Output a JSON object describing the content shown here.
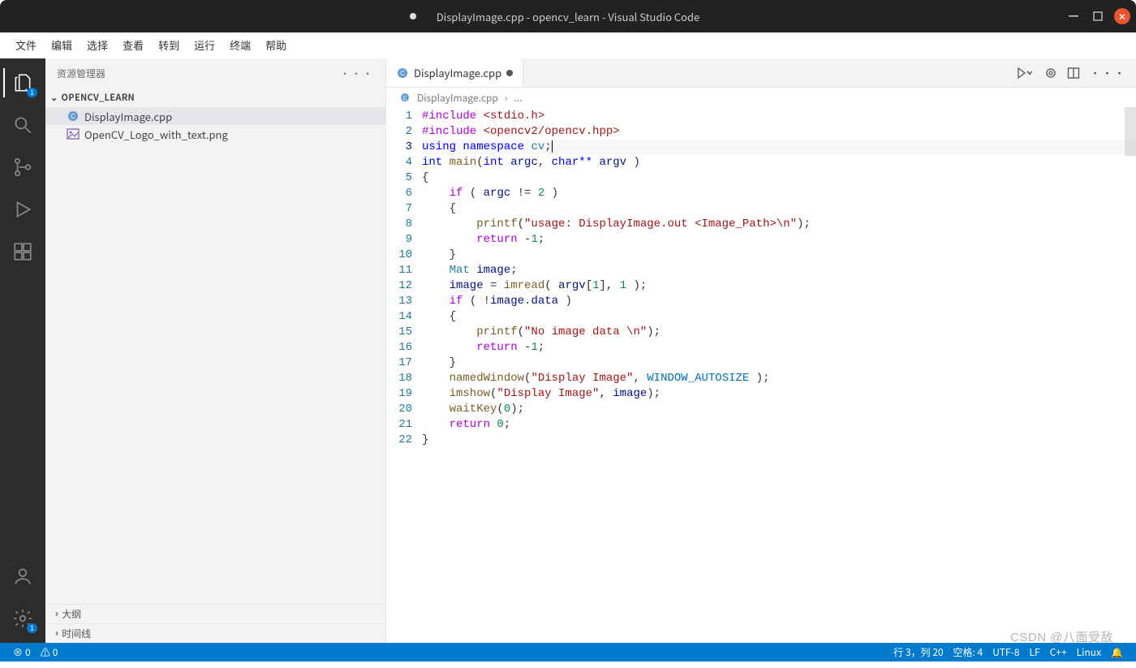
{
  "window": {
    "title": "DisplayImage.cpp - opencv_learn - Visual Studio Code",
    "modified": true
  },
  "menubar": {
    "items": [
      "文件",
      "编辑",
      "选择",
      "查看",
      "转到",
      "运行",
      "终端",
      "帮助"
    ]
  },
  "activitybar": {
    "top": [
      {
        "name": "explorer",
        "badge": "1",
        "active": true
      },
      {
        "name": "search"
      },
      {
        "name": "source-control"
      },
      {
        "name": "run-debug"
      },
      {
        "name": "extensions"
      }
    ],
    "bottom": [
      {
        "name": "accounts"
      },
      {
        "name": "manage",
        "badge": "1"
      }
    ]
  },
  "sidebar": {
    "title": "资源管理器",
    "more": "···",
    "folder": "OPENCV_LEARN",
    "files": [
      {
        "name": "DisplayImage.cpp",
        "icon": "cpp",
        "active": true
      },
      {
        "name": "OpenCV_Logo_with_text.png",
        "icon": "image",
        "active": false
      }
    ],
    "sections": [
      {
        "label": "大纲"
      },
      {
        "label": "时间线"
      }
    ]
  },
  "editor": {
    "tab": {
      "label": "DisplayImage.cpp",
      "modified": true
    },
    "breadcrumb": {
      "file": "DisplayImage.cpp",
      "segment": "..."
    },
    "toolbar_icons": [
      "run-dropdown",
      "split-icon",
      "layout-icon",
      "more-icon"
    ],
    "lines": 22,
    "cursor_line": 3,
    "code": [
      [
        {
          "t": "#include ",
          "c": "k-pp"
        },
        {
          "t": "<stdio.h>",
          "c": "k-str"
        }
      ],
      [
        {
          "t": "#include ",
          "c": "k-pp"
        },
        {
          "t": "<opencv2/opencv.hpp>",
          "c": "k-str"
        }
      ],
      [
        {
          "t": "using ",
          "c": "k-kw"
        },
        {
          "t": "namespace ",
          "c": "k-kw"
        },
        {
          "t": "cv",
          "c": "k-type"
        },
        {
          "t": ";",
          "c": ""
        }
      ],
      [
        {
          "t": "int ",
          "c": "k-kw"
        },
        {
          "t": "main",
          "c": "k-fn"
        },
        {
          "t": "(",
          "c": ""
        },
        {
          "t": "int ",
          "c": "k-kw"
        },
        {
          "t": "argc",
          "c": "k-var"
        },
        {
          "t": ", ",
          "c": ""
        },
        {
          "t": "char** ",
          "c": "k-kw"
        },
        {
          "t": "argv",
          "c": "k-var"
        },
        {
          "t": " )",
          "c": ""
        }
      ],
      [
        {
          "t": "{",
          "c": ""
        }
      ],
      [
        {
          "t": "    if",
          "c": "k-pp"
        },
        {
          "t": " ( ",
          "c": ""
        },
        {
          "t": "argc",
          "c": "k-var"
        },
        {
          "t": " != ",
          "c": ""
        },
        {
          "t": "2",
          "c": "k-num"
        },
        {
          "t": " )",
          "c": ""
        }
      ],
      [
        {
          "t": "    {",
          "c": ""
        }
      ],
      [
        {
          "t": "        printf",
          "c": "k-fn"
        },
        {
          "t": "(",
          "c": ""
        },
        {
          "t": "\"usage: DisplayImage.out <Image_Path>\\n\"",
          "c": "k-str"
        },
        {
          "t": ");",
          "c": ""
        }
      ],
      [
        {
          "t": "        return ",
          "c": "k-pp"
        },
        {
          "t": "-",
          "c": ""
        },
        {
          "t": "1",
          "c": "k-num"
        },
        {
          "t": ";",
          "c": ""
        }
      ],
      [
        {
          "t": "    }",
          "c": ""
        }
      ],
      [
        {
          "t": "    Mat",
          "c": "k-type"
        },
        {
          "t": " ",
          "c": ""
        },
        {
          "t": "image",
          "c": "k-var"
        },
        {
          "t": ";",
          "c": ""
        }
      ],
      [
        {
          "t": "    image",
          "c": "k-var"
        },
        {
          "t": " = ",
          "c": ""
        },
        {
          "t": "imread",
          "c": "k-fn"
        },
        {
          "t": "( ",
          "c": ""
        },
        {
          "t": "argv",
          "c": "k-var"
        },
        {
          "t": "[",
          "c": ""
        },
        {
          "t": "1",
          "c": "k-num"
        },
        {
          "t": "], ",
          "c": ""
        },
        {
          "t": "1",
          "c": "k-num"
        },
        {
          "t": " );",
          "c": ""
        }
      ],
      [
        {
          "t": "    if",
          "c": "k-pp"
        },
        {
          "t": " ( !",
          "c": ""
        },
        {
          "t": "image",
          "c": "k-var"
        },
        {
          "t": ".",
          "c": ""
        },
        {
          "t": "data",
          "c": "k-var"
        },
        {
          "t": " )",
          "c": ""
        }
      ],
      [
        {
          "t": "    {",
          "c": ""
        }
      ],
      [
        {
          "t": "        printf",
          "c": "k-fn"
        },
        {
          "t": "(",
          "c": ""
        },
        {
          "t": "\"No image data \\n\"",
          "c": "k-str"
        },
        {
          "t": ");",
          "c": ""
        }
      ],
      [
        {
          "t": "        return ",
          "c": "k-pp"
        },
        {
          "t": "-",
          "c": ""
        },
        {
          "t": "1",
          "c": "k-num"
        },
        {
          "t": ";",
          "c": ""
        }
      ],
      [
        {
          "t": "    }",
          "c": ""
        }
      ],
      [
        {
          "t": "    namedWindow",
          "c": "k-fn"
        },
        {
          "t": "(",
          "c": ""
        },
        {
          "t": "\"Display Image\"",
          "c": "k-str"
        },
        {
          "t": ", ",
          "c": ""
        },
        {
          "t": "WINDOW_AUTOSIZE",
          "c": "k-const"
        },
        {
          "t": " );",
          "c": ""
        }
      ],
      [
        {
          "t": "    imshow",
          "c": "k-fn"
        },
        {
          "t": "(",
          "c": ""
        },
        {
          "t": "\"Display Image\"",
          "c": "k-str"
        },
        {
          "t": ", ",
          "c": ""
        },
        {
          "t": "image",
          "c": "k-var"
        },
        {
          "t": ");",
          "c": ""
        }
      ],
      [
        {
          "t": "    waitKey",
          "c": "k-fn"
        },
        {
          "t": "(",
          "c": ""
        },
        {
          "t": "0",
          "c": "k-num"
        },
        {
          "t": ");",
          "c": ""
        }
      ],
      [
        {
          "t": "    return ",
          "c": "k-pp"
        },
        {
          "t": "0",
          "c": "k-num"
        },
        {
          "t": ";",
          "c": ""
        }
      ],
      [
        {
          "t": "}",
          "c": ""
        }
      ]
    ]
  },
  "statusbar": {
    "left": [
      {
        "icon": "error",
        "text": "0"
      },
      {
        "icon": "warning",
        "text": "0"
      }
    ],
    "right": [
      {
        "text": "行 3，列 20"
      },
      {
        "text": "空格: 4"
      },
      {
        "text": "UTF-8"
      },
      {
        "text": "LF"
      },
      {
        "text": "C++"
      },
      {
        "text": "Linux"
      },
      {
        "icon": "bell"
      }
    ]
  },
  "watermark": "CSDN @八面受敌"
}
